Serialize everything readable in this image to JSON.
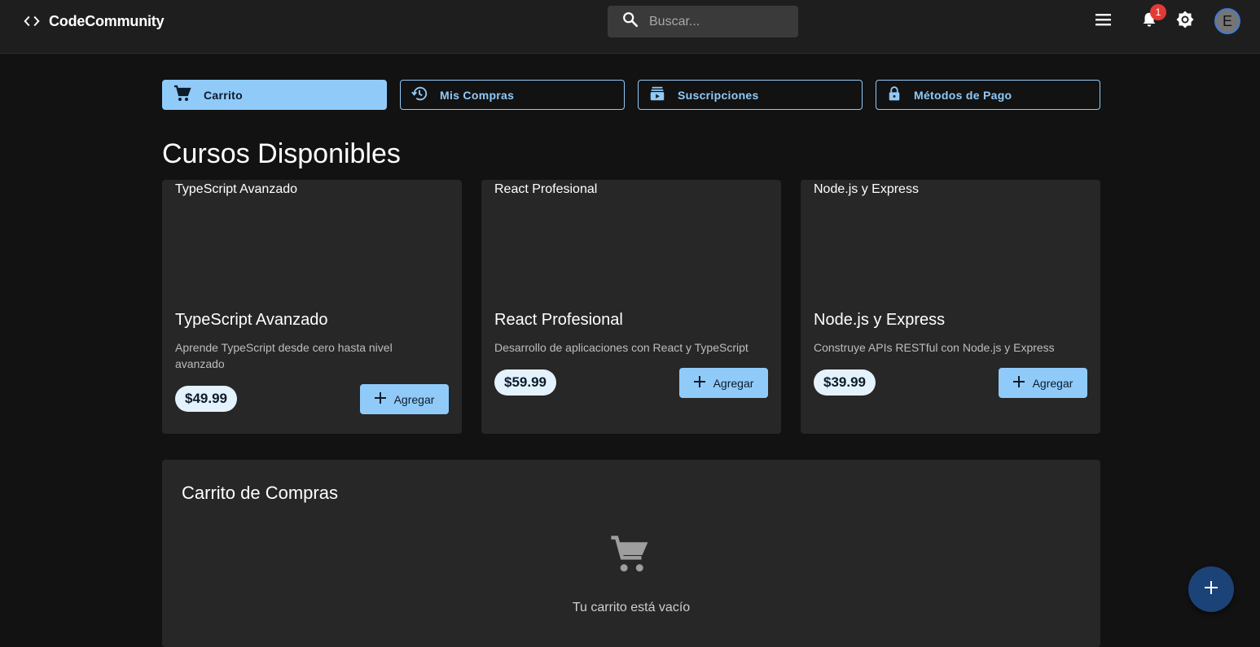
{
  "header": {
    "brand_name": "CodeCommunity",
    "search_placeholder": "Buscar...",
    "notification_count": "1",
    "avatar_initial": "E",
    "icons": [
      "code-icon",
      "search-icon",
      "menu-icon",
      "bell-icon",
      "brightness-icon"
    ]
  },
  "tabs": [
    {
      "label": "Carrito",
      "icon": "cart-icon",
      "active": true
    },
    {
      "label": "Mis Compras",
      "icon": "history-icon",
      "active": false
    },
    {
      "label": "Suscripciones",
      "icon": "subscriptions-icon",
      "active": false
    },
    {
      "label": "Métodos de Pago",
      "icon": "lock-icon",
      "active": false
    }
  ],
  "courses_section": {
    "title": "Cursos Disponibles",
    "courses": [
      {
        "image_alt": "TypeScript Avanzado",
        "title": "TypeScript Avanzado",
        "description": "Aprende TypeScript desde cero hasta nivel avanzado",
        "price": "$49.99",
        "add_label": "Agregar"
      },
      {
        "image_alt": "React Profesional",
        "title": "React Profesional",
        "description": "Desarrollo de aplicaciones con React y TypeScript",
        "price": "$59.99",
        "add_label": "Agregar"
      },
      {
        "image_alt": "Node.js y Express",
        "title": "Node.js y Express",
        "description": "Construye APIs RESTful con Node.js y Express",
        "price": "$39.99",
        "add_label": "Agregar"
      }
    ]
  },
  "cart": {
    "title": "Carrito de Compras",
    "empty_message": "Tu carrito está vacío"
  },
  "colors": {
    "accent": "#90caf9",
    "background": "#121212",
    "surface": "#272727",
    "badge": "#e53935",
    "fab": "#1b4377"
  }
}
